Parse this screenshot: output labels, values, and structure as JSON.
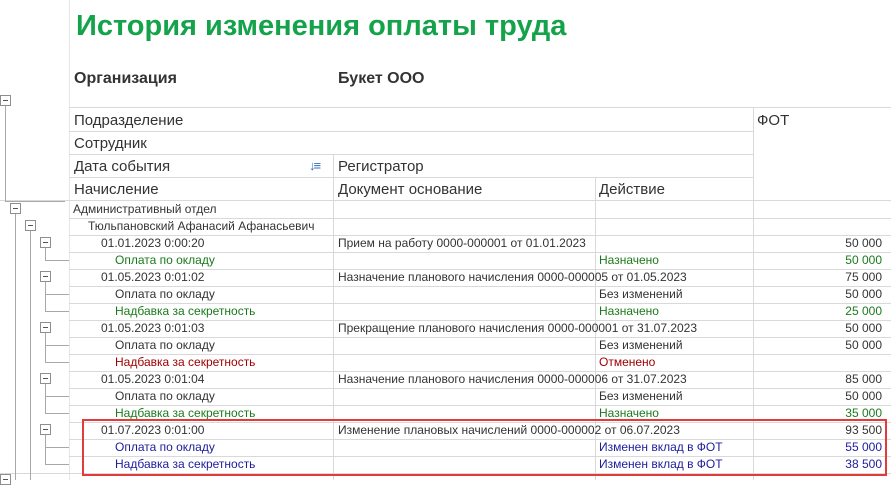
{
  "title": "История изменения оплаты труда",
  "org": {
    "label": "Организация",
    "value": "Букет ООО"
  },
  "headers": {
    "subdivision": "Подразделение",
    "employee": "Сотрудник",
    "event_date": "Дата события",
    "registrar": "Регистратор",
    "accrual": "Начисление",
    "basis_doc": "Документ основание",
    "action": "Действие",
    "fot": "ФОТ"
  },
  "rows": {
    "dept": "Административный отдел",
    "employee": "Тюльпановский Афанасий Афанасьевич",
    "e1": {
      "date": "01.01.2023 0:00:20",
      "doc": "Прием на работу 0000-000001 от 01.01.2023",
      "fot": "50 000"
    },
    "e1r1": {
      "name": "Оплата по окладу",
      "action": "Назначено",
      "fot": "50 000"
    },
    "e2": {
      "date": "01.05.2023 0:01:02",
      "doc": "Назначение планового начисления 0000-000005 от 01.05.2023",
      "fot": "75 000"
    },
    "e2r1": {
      "name": "Оплата по окладу",
      "action": "Без изменений",
      "fot": "50 000"
    },
    "e2r2": {
      "name": "Надбавка за секретность",
      "action": "Назначено",
      "fot": "25 000"
    },
    "e3": {
      "date": "01.05.2023 0:01:03",
      "doc": "Прекращение планового начисления 0000-000001 от 31.07.2023",
      "fot": "50 000"
    },
    "e3r1": {
      "name": "Оплата по окладу",
      "action": "Без изменений",
      "fot": "50 000"
    },
    "e3r2": {
      "name": "Надбавка за секретность",
      "action": "Отменено"
    },
    "e4": {
      "date": "01.05.2023 0:01:04",
      "doc": "Назначение планового начисления 0000-000006 от 31.07.2023",
      "fot": "85 000"
    },
    "e4r1": {
      "name": "Оплата по окладу",
      "action": "Без изменений",
      "fot": "50 000"
    },
    "e4r2": {
      "name": "Надбавка за секретность",
      "action": "Назначено",
      "fot": "35 000"
    },
    "e5": {
      "date": "01.07.2023 0:01:00",
      "doc": "Изменение плановых начислений 0000-000002 от 06.07.2023",
      "fot": "93 500"
    },
    "e5r1": {
      "name": "Оплата по окладу",
      "action": "Изменен вклад в ФОТ",
      "fot": "55 000"
    },
    "e5r2": {
      "name": "Надбавка за секретность",
      "action": "Изменен вклад в ФОТ",
      "fot": "38 500"
    }
  },
  "colors": {
    "title": "#14a34a",
    "green": "#1a7a1a",
    "red": "#a00000",
    "blue": "#1c1c9c",
    "highlight": "#e23b3b"
  }
}
